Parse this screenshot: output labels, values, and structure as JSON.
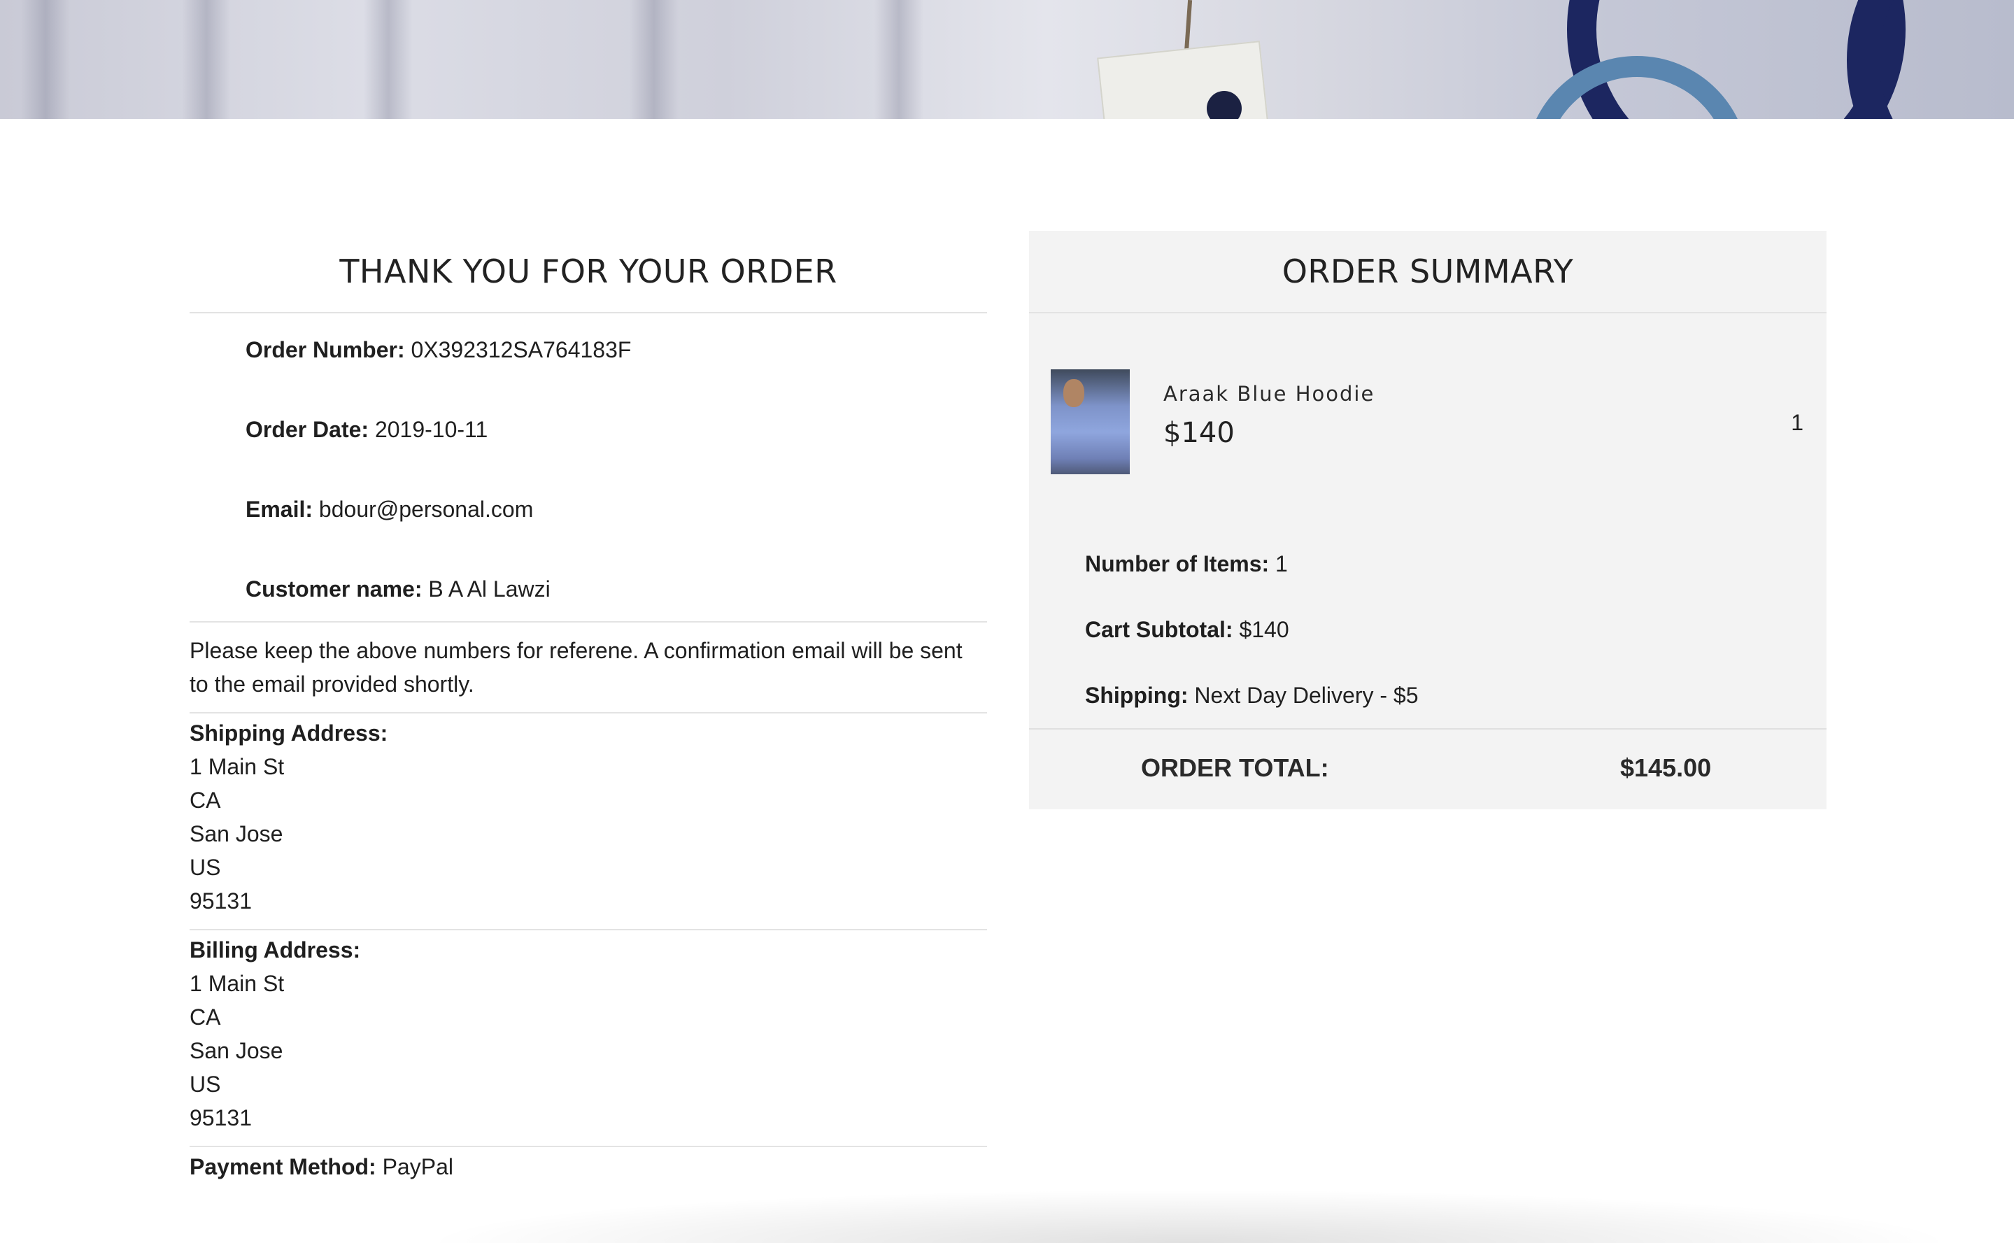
{
  "confirmation": {
    "title": "THANK YOU FOR YOUR ORDER",
    "order_number_label": "Order Number:",
    "order_number": "0X392312SA764183F",
    "order_date_label": "Order Date:",
    "order_date": "2019-10-11",
    "email_label": "Email:",
    "email": "bdour@personal.com",
    "customer_name_label": "Customer name:",
    "customer_name": "B A Al Lawzi",
    "note": "Please keep the above numbers for referene. A confirmation email will be sent to the email provided shortly.",
    "shipping_address": {
      "label": "Shipping Address:",
      "lines": [
        "1 Main St",
        "CA",
        "San Jose",
        "US",
        "95131"
      ]
    },
    "billing_address": {
      "label": "Billing Address:",
      "lines": [
        "1 Main St",
        "CA",
        "San Jose",
        "US",
        "95131"
      ]
    },
    "payment_method_label": "Payment Method:",
    "payment_method": "PayPal"
  },
  "summary": {
    "title": "ORDER SUMMARY",
    "items": [
      {
        "name": "Araak Blue Hoodie",
        "price": "$140",
        "quantity": "1"
      }
    ],
    "number_of_items_label": "Number of Items:",
    "number_of_items": "1",
    "cart_subtotal_label": "Cart Subtotal:",
    "cart_subtotal": "$140",
    "shipping_label": "Shipping:",
    "shipping": "Next Day Delivery - $5",
    "order_total_label": "ORDER TOTAL:",
    "order_total": "$145.00"
  },
  "colors": {
    "panel_background": "#f3f3f3",
    "divider": "#e3e3e3",
    "text": "#1f1f1f"
  }
}
